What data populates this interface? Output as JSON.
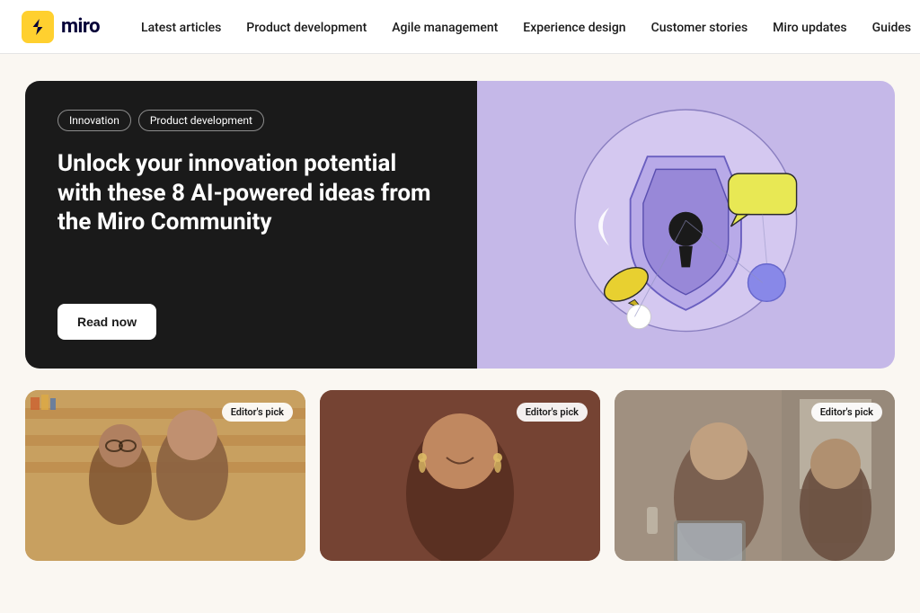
{
  "brand": {
    "logo_text": "miro",
    "logo_alt": "Miro logo"
  },
  "nav": {
    "links": [
      {
        "label": "Latest articles",
        "id": "latest-articles"
      },
      {
        "label": "Product development",
        "id": "product-development"
      },
      {
        "label": "Agile management",
        "id": "agile-management"
      },
      {
        "label": "Experience design",
        "id": "experience-design"
      },
      {
        "label": "Customer stories",
        "id": "customer-stories"
      },
      {
        "label": "Miro updates",
        "id": "miro-updates"
      },
      {
        "label": "Guides",
        "id": "guides"
      }
    ]
  },
  "hero": {
    "tag1": "Innovation",
    "tag2": "Product development",
    "title": "Unlock your innovation potential with these 8 AI-powered ideas from the Miro Community",
    "cta_label": "Read now"
  },
  "cards": [
    {
      "badge": "Editor's pick",
      "id": "card-1"
    },
    {
      "badge": "Editor's pick",
      "id": "card-2"
    },
    {
      "badge": "Editor's pick",
      "id": "card-3"
    }
  ],
  "colors": {
    "accent_purple": "#c5b8e8",
    "dark_bg": "#1a1a1a",
    "page_bg": "#faf7f2"
  }
}
